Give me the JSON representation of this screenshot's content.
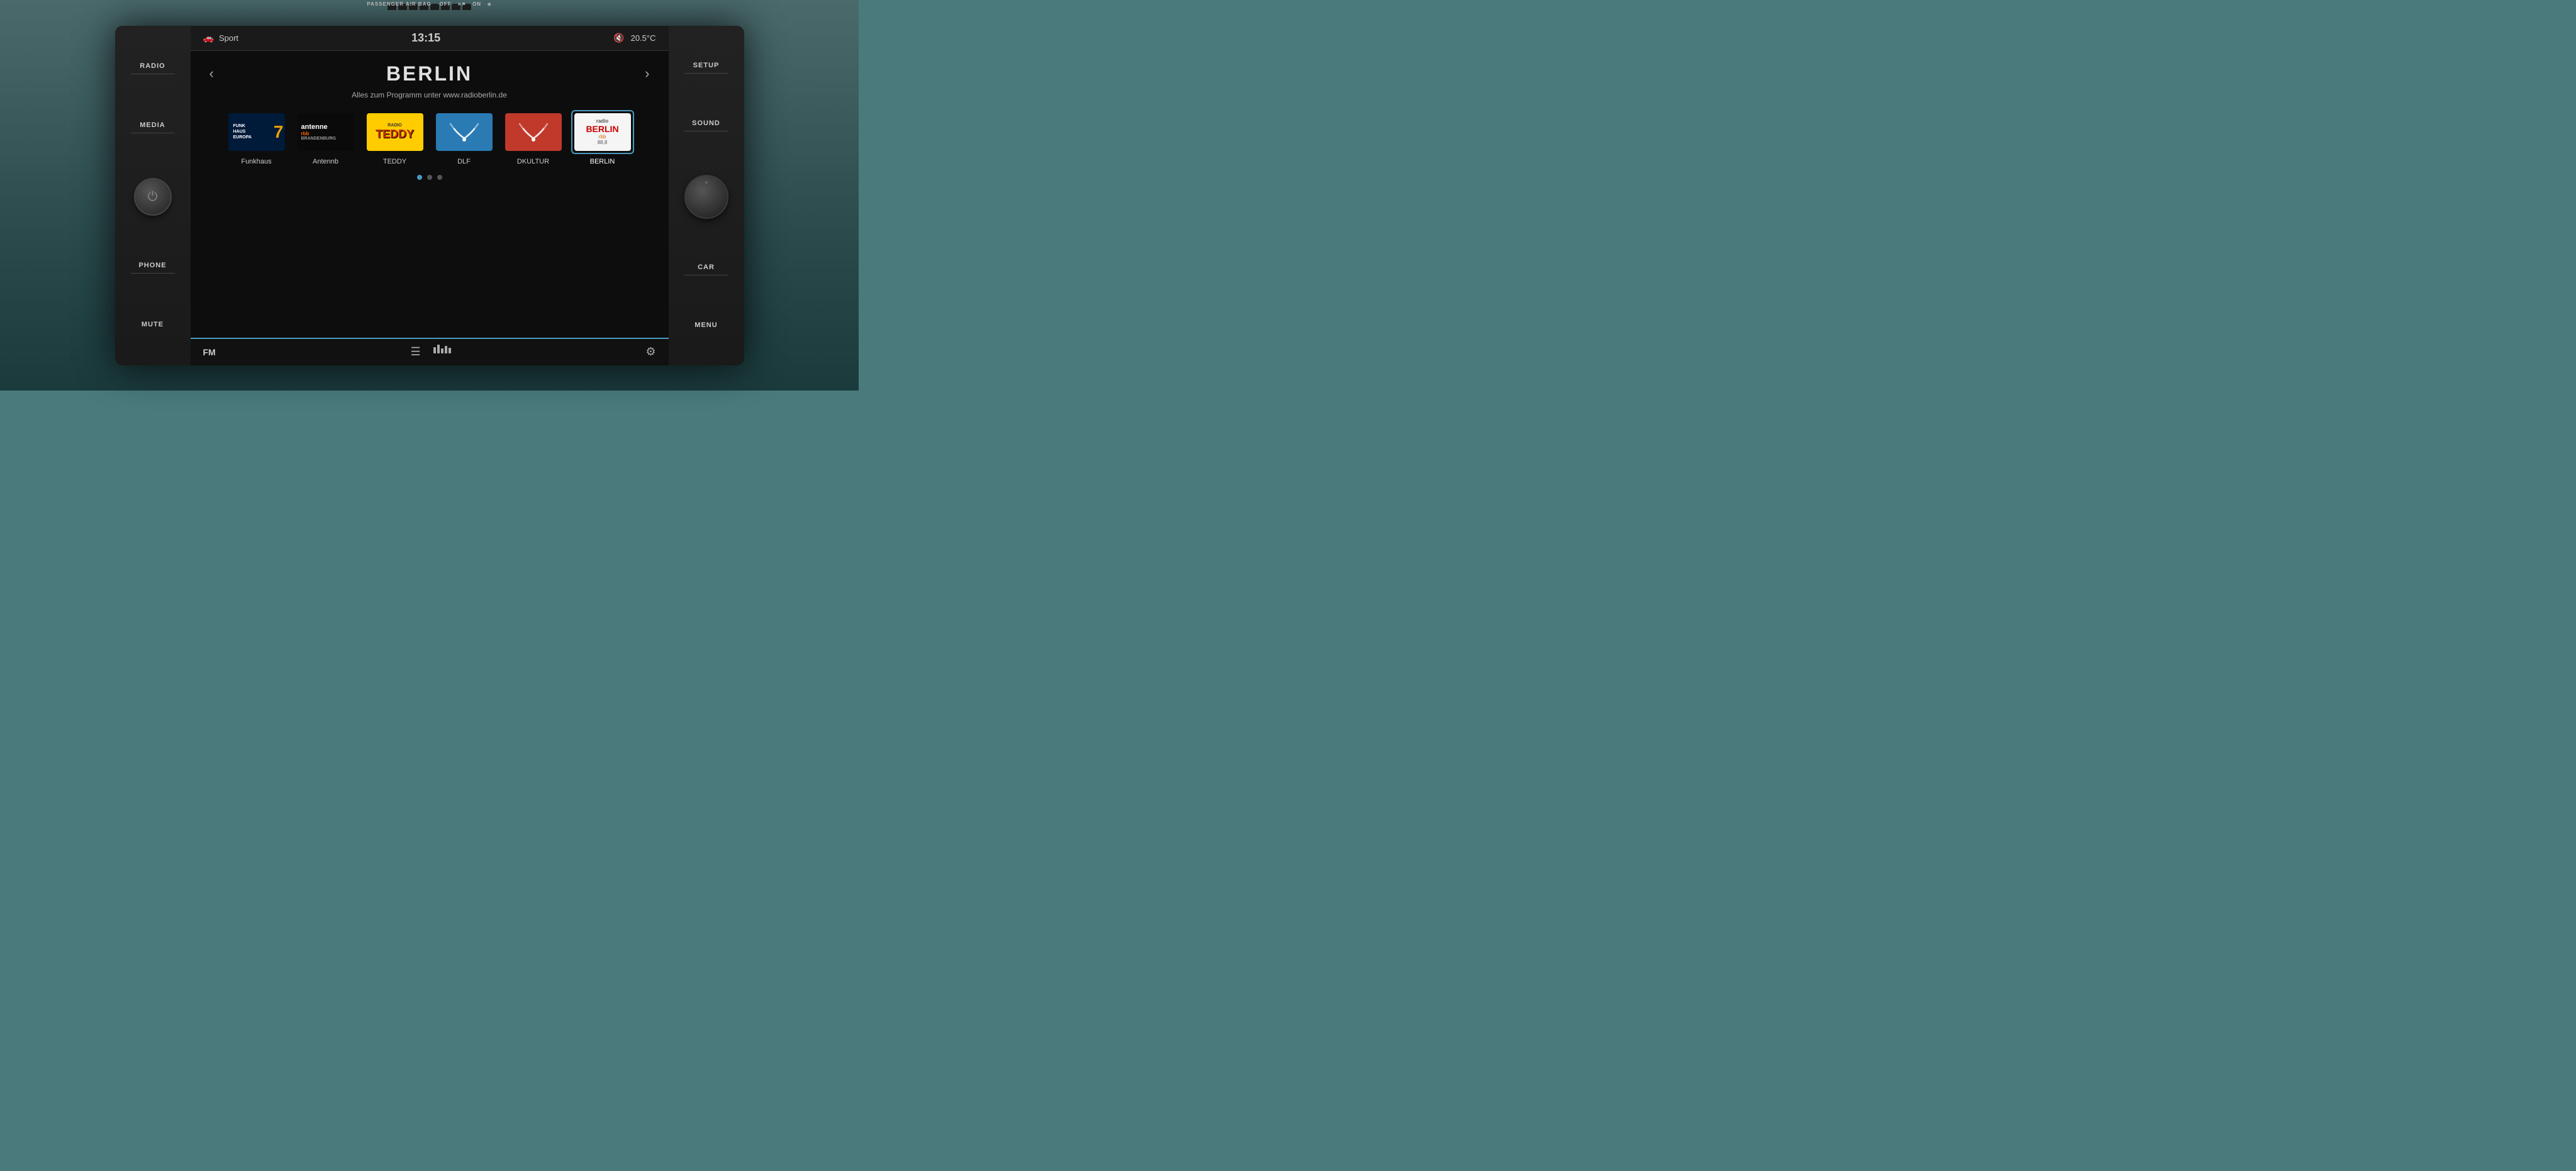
{
  "airbag": {
    "label": "PASSENGER AIR BAG",
    "off_label": "OFF",
    "on_label": "ON"
  },
  "left_controls": {
    "radio_label": "RADIO",
    "media_label": "MEDIA",
    "phone_label": "PHONE",
    "mute_label": "MUTE"
  },
  "right_controls": {
    "setup_label": "SETUP",
    "sound_label": "SOUND",
    "car_label": "CAR",
    "menu_label": "MENU"
  },
  "status_bar": {
    "drive_mode": "Sport",
    "time": "13:15",
    "temperature": "20.5°C"
  },
  "station": {
    "current": "BERLIN",
    "subtitle": "Alles zum Programm unter www.radioberlin.de"
  },
  "stations": [
    {
      "id": "funkhaus",
      "label": "Funkhaus",
      "logo_line1": "FUNK",
      "logo_line2": "HAUS",
      "logo_line3": "EUROPA",
      "active": false
    },
    {
      "id": "antenne",
      "label": "Antennb",
      "active": false
    },
    {
      "id": "teddy",
      "label": "TEDDY",
      "active": false
    },
    {
      "id": "dlf",
      "label": "DLF",
      "active": false
    },
    {
      "id": "dkultur",
      "label": "DKULTUR",
      "active": false
    },
    {
      "id": "berlin",
      "label": "BERLIN",
      "active": true
    }
  ],
  "pagination": {
    "total_dots": 3,
    "active_dot": 0
  },
  "bottom_bar": {
    "band": "FM"
  },
  "colors": {
    "accent_blue": "#4a9abf",
    "background_dark": "#0d0d0d",
    "screen_bg": "#111111",
    "teal": "#4a7a7c"
  }
}
